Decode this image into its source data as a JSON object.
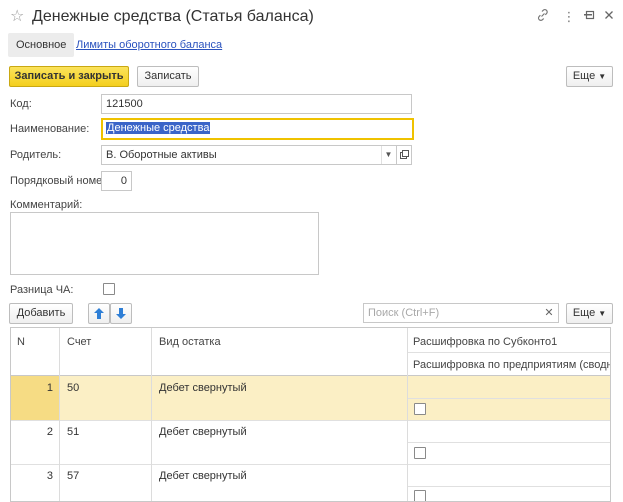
{
  "window": {
    "title": "Денежные средства (Статья  баланса)",
    "icons": [
      "link-icon",
      "more-vertical-icon",
      "minimize-icon",
      "maximize-icon",
      "close-icon"
    ]
  },
  "tabs": [
    {
      "label": "Основное",
      "active": true
    },
    {
      "label": "Лимиты оборотного баланса",
      "active": false
    }
  ],
  "toolbar": {
    "save_close_label": "Записать и закрыть",
    "save_label": "Записать",
    "more_label": "Еще"
  },
  "form": {
    "code_label": "Код:",
    "code_value": "121500",
    "name_label": "Наименование:",
    "name_value": "Денежные средства",
    "parent_label": "Родитель:",
    "parent_value": "В. Оборотные активы",
    "order_label": "Порядковый номер:",
    "order_value": "0",
    "comment_label": "Комментарий:",
    "comment_value": "",
    "diff_label": "Разница ЧА:",
    "diff_checked": false
  },
  "table_toolbar": {
    "add_label": "Добавить",
    "search_placeholder": "Поиск (Ctrl+F)",
    "more_label": "Еще"
  },
  "table": {
    "columns": {
      "n": "N",
      "account": "Счет",
      "balance_type": "Вид остатка",
      "subconto": "Расшифровка по Субконто1",
      "enterprises": "Расшифровка по предприятиям (сводный)"
    },
    "rows": [
      {
        "n": "1",
        "account": "50",
        "balance_type": "Дебет свернутый",
        "selected": true
      },
      {
        "n": "2",
        "account": "51",
        "balance_type": "Дебет свернутый",
        "selected": false
      },
      {
        "n": "3",
        "account": "57",
        "balance_type": "Дебет свернутый",
        "selected": false
      }
    ]
  },
  "colors": {
    "accent_yellow": "#f4cf1e",
    "link_blue": "#2a52be",
    "row_selected": "#fbefc5",
    "arrow_blue": "#2f7fd6"
  }
}
